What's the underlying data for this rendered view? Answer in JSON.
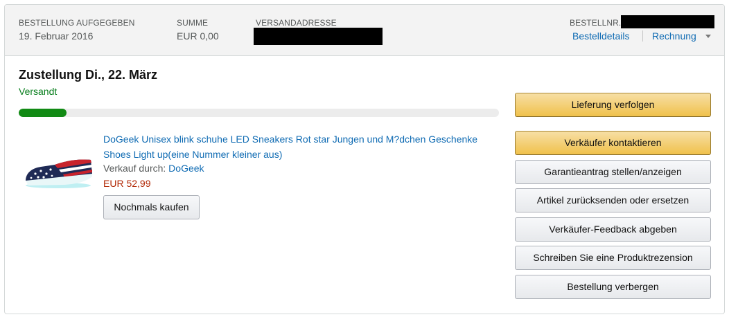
{
  "header": {
    "order_placed_label": "BESTELLUNG AUFGEGEBEN",
    "order_placed_value": "19. Februar 2016",
    "total_label": "SUMME",
    "total_value": "EUR 0,00",
    "ship_to_label": "VERSANDADRESSE",
    "order_number_label": "BESTELLNR.",
    "details_link": "Bestelldetails",
    "invoice_link": "Rechnung"
  },
  "delivery": {
    "title": "Zustellung Di., 22. März",
    "status": "Versandt",
    "progress": 0.1
  },
  "item": {
    "title": "DoGeek Unisex blink schuhe LED Sneakers Rot star Jungen und M?dchen Geschenke Shoes Light up(eine Nummer kleiner aus)",
    "sold_by_label": "Verkauf durch:",
    "seller": "DoGeek",
    "price": "EUR 52,99",
    "buy_again": "Nochmals kaufen"
  },
  "actions": {
    "track": "Lieferung verfolgen",
    "contact_seller": "Verkäufer kontaktieren",
    "guarantee": "Garantieantrag stellen/anzeigen",
    "return": "Artikel zurücksenden oder ersetzen",
    "seller_feedback": "Verkäufer-Feedback abgeben",
    "review": "Schreiben Sie eine Produktrezension",
    "hide": "Bestellung verbergen"
  },
  "icons": {
    "invoice_caret": "chevron-down-icon",
    "thumbnail": "sneaker-image"
  }
}
